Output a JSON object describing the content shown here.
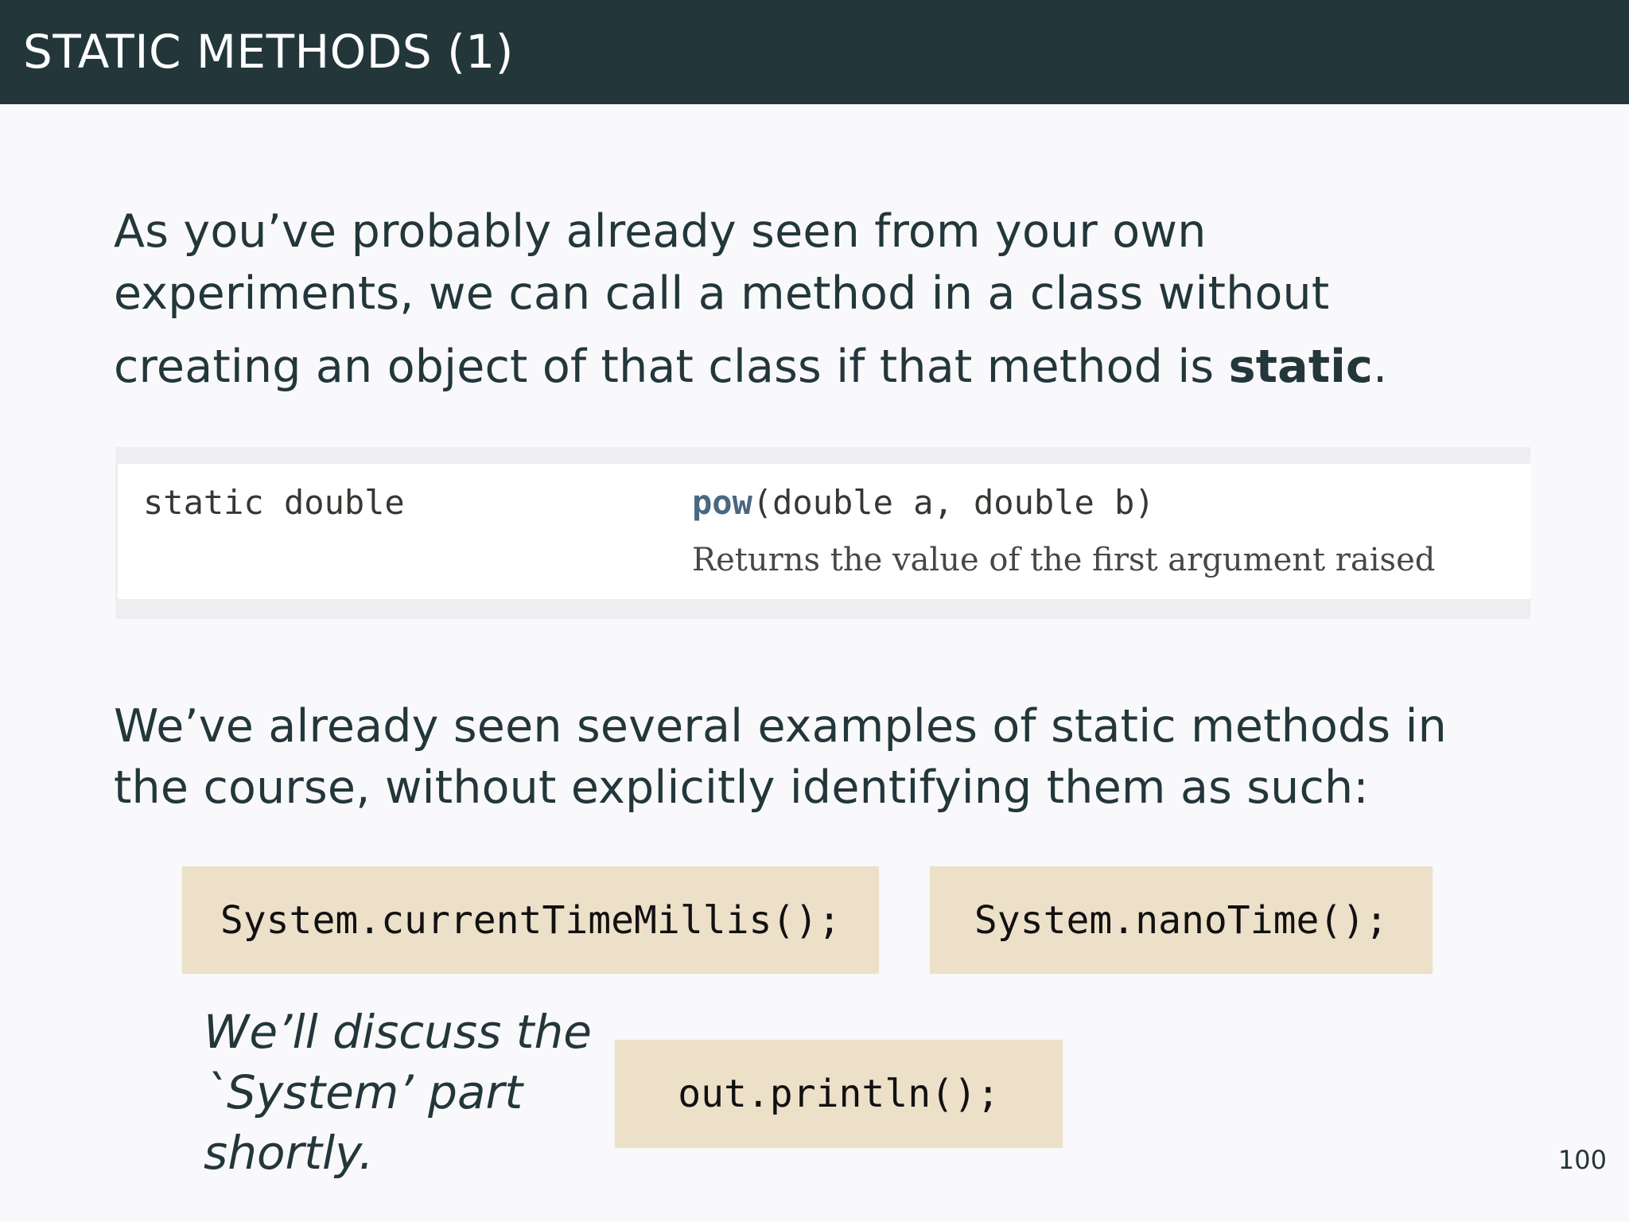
{
  "slide": {
    "title": "STATIC METHODS (1)",
    "page_number": "100"
  },
  "intro": {
    "line1": "As you’ve probably already seen from your own",
    "line2": "experiments, we can call a method in a class without",
    "line3_before": "creating an object of that class if that method is ",
    "line3_bold": "static",
    "line3_after": "."
  },
  "javadoc": {
    "modifier_and_type": "static double",
    "method_name": "pow",
    "method_params": "(double a, double b)",
    "description": "Returns the value of the first argument raised"
  },
  "examples_intro": {
    "line1": "We’ve already seen several examples of static methods in",
    "line2": "the course, without explicitly identifying them as such:"
  },
  "code_examples": {
    "example1": "System.currentTimeMillis();",
    "example2": "System.nanoTime();",
    "example3": "out.println();"
  },
  "note": {
    "line1": "We’ll discuss the",
    "line2": "`System’ part",
    "line3": "shortly."
  },
  "colors": {
    "title_bar": "#23373b",
    "background": "#f9f9fb",
    "code_box": "#ede0c9",
    "method_link": "#4a6782"
  }
}
